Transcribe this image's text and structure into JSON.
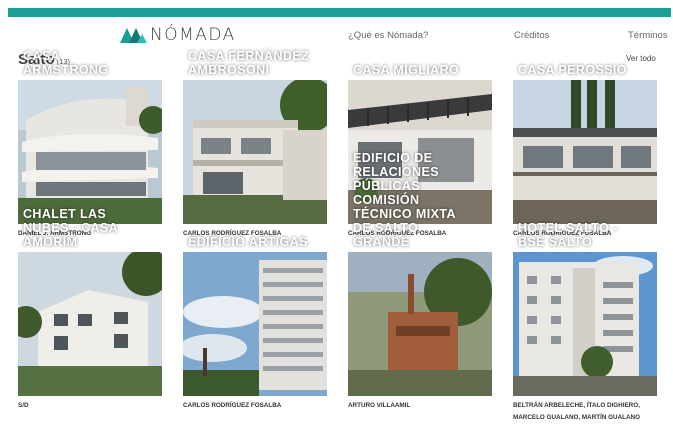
{
  "colors": {
    "accent": "#1a9e96",
    "title_overlay": "#ffffff"
  },
  "header": {
    "brand": "NÓMADA",
    "logo_icon": "nomada-logo-icon",
    "nav": [
      "¿Qué es Nómada?",
      "Créditos",
      "Términos"
    ]
  },
  "section": {
    "title": "Salto",
    "count": "(13)",
    "view_all": "Ver todo"
  },
  "cards": [
    {
      "title": "CASA\nARMSTRONG",
      "author": "DANIEL J. ARMSTRONG"
    },
    {
      "title": "CASA FERNÁNDEZ\nAMBROSONI",
      "author": "CARLOS RODRÍGUEZ FOSALBA"
    },
    {
      "title": "CASA MIGLIARO",
      "author": "CARLOS RODRÍGUEZ FOSALBA"
    },
    {
      "title": "CASA PEROSSIO",
      "author": "CARLOS RODRÍGUEZ FOSALBA"
    },
    {
      "title": "CHALET LAS\nNUBES - CASA\nAMORIM",
      "author": "S/D"
    },
    {
      "title": "EDIFICIO ARTIGAS",
      "author": "CARLOS RODRÍGUEZ FOSALBA"
    },
    {
      "title": "EDIFICIO DE\nRELACIONES\nPÚBLICAS\nCOMISIÓN\nTÉCNICO MIXTA\nDE SALTO\nGRANDE",
      "author": "ARTURO VILLAAMIL"
    },
    {
      "title": "HOTEL SALTO -\nBSE SALTO",
      "author": "BELTRÁN ARBELECHE, ÍTALO DIGHIERO, MARCELO GUALANO, MARTÍN GUALANO"
    }
  ]
}
